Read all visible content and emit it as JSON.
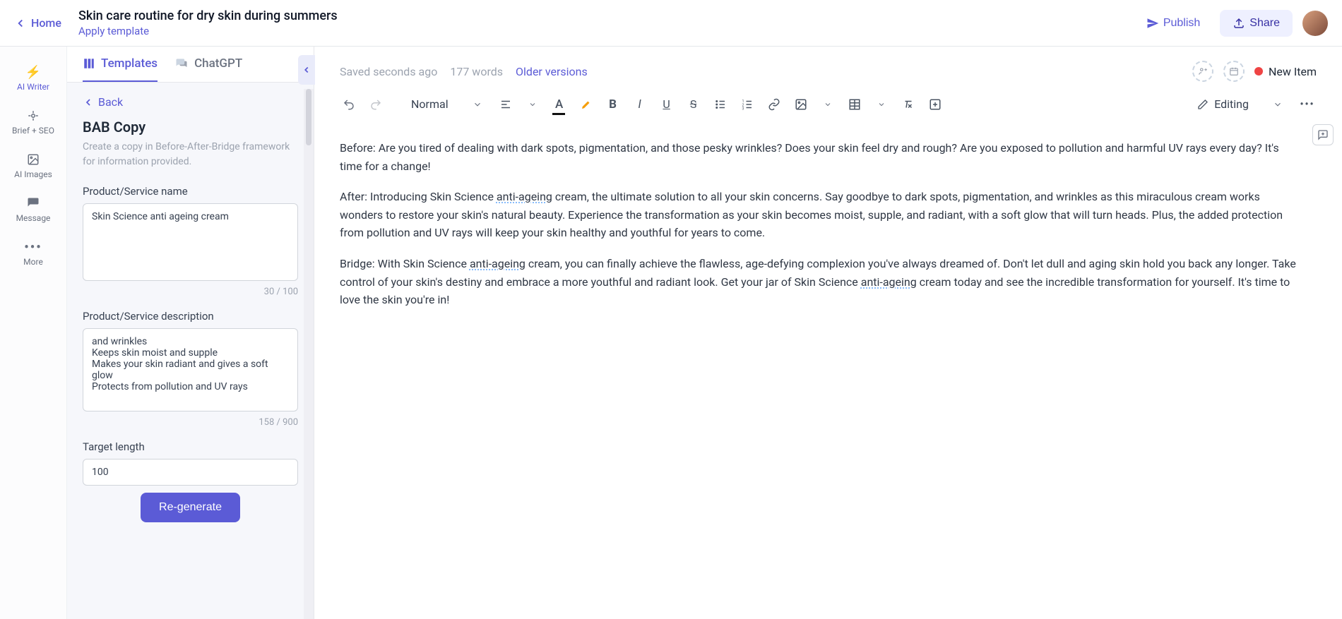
{
  "header": {
    "home": "Home",
    "title": "Skin care routine for dry skin during summers",
    "apply_template": "Apply template",
    "publish": "Publish",
    "share": "Share"
  },
  "rail": {
    "ai_writer": "AI Writer",
    "brief_seo": "Brief + SEO",
    "ai_images": "AI Images",
    "message": "Message",
    "more": "More"
  },
  "sidebar": {
    "tabs": {
      "templates": "Templates",
      "chatgpt": "ChatGPT"
    },
    "back": "Back",
    "panel_title": "BAB Copy",
    "panel_desc": "Create a copy in Before-After-Bridge framework for information provided.",
    "product_name_label": "Product/Service name",
    "product_name_value": "Skin Science anti ageing cream",
    "product_name_count": "30 / 100",
    "product_desc_label": "Product/Service description",
    "product_desc_value": "and wrinkles\nKeeps skin moist and supple\nMakes your skin radiant and gives a soft glow\nProtects from pollution and UV rays",
    "product_desc_count": "158 / 900",
    "target_length_label": "Target length",
    "target_length_value": "100",
    "regenerate": "Re-generate"
  },
  "editor": {
    "saved": "Saved seconds ago",
    "word_count": "177 words",
    "older_versions": "Older versions",
    "new_item": "New Item",
    "paragraph_style": "Normal",
    "editing_mode": "Editing",
    "content": {
      "before": "Before: Are you tired of dealing with dark spots, pigmentation, and those pesky wrinkles? Does your skin feel dry and rough? Are you exposed to pollution and harmful UV rays every day? It's time for a change!",
      "after_1": "After: Introducing Skin Science ",
      "after_dotted": "anti-ageing",
      "after_2": " cream, the ultimate solution to all your skin concerns. Say goodbye to dark spots, pigmentation, and wrinkles as this miraculous cream works wonders to restore your skin's natural beauty. Experience the transformation as your skin becomes moist, supple, and radiant, with a soft glow that will turn heads. Plus, the added protection from pollution and UV rays will keep your skin healthy and youthful for years to come.",
      "bridge_1": "Bridge: With Skin Science ",
      "bridge_dotted1": "anti-ageing",
      "bridge_2": " cream, you can finally achieve the flawless, age-defying complexion you've always dreamed of. Don't let dull and aging skin hold you back any longer. Take control of your skin's destiny and embrace a more youthful and radiant look. Get your jar of Skin Science ",
      "bridge_dotted2": "anti-ageing",
      "bridge_3": " cream today and see the incredible transformation for yourself. It's time to love the skin you're in!"
    }
  }
}
